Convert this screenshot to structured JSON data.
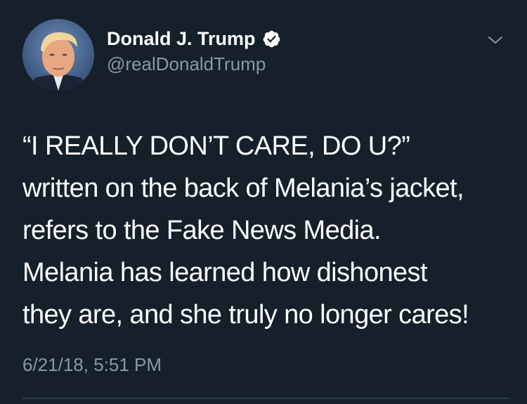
{
  "tweet": {
    "author": {
      "display_name": "Donald J. Trump",
      "handle": "@realDonaldTrump",
      "verified": true
    },
    "text": "“I REALLY DON’T CARE, DO U?”\nwritten on the back of Melania’s jacket,\nrefers to the Fake News Media.\nMelania has learned how dishonest\nthey are, and she truly no longer cares!",
    "timestamp": "6/21/18, 5:51 PM"
  },
  "icons": {
    "verified": "verified-badge-icon",
    "menu": "chevron-down-icon"
  },
  "colors": {
    "background": "#15202b",
    "primary_text": "#ffffff",
    "secondary_text": "#8899a6",
    "divider": "#2f3b47"
  }
}
